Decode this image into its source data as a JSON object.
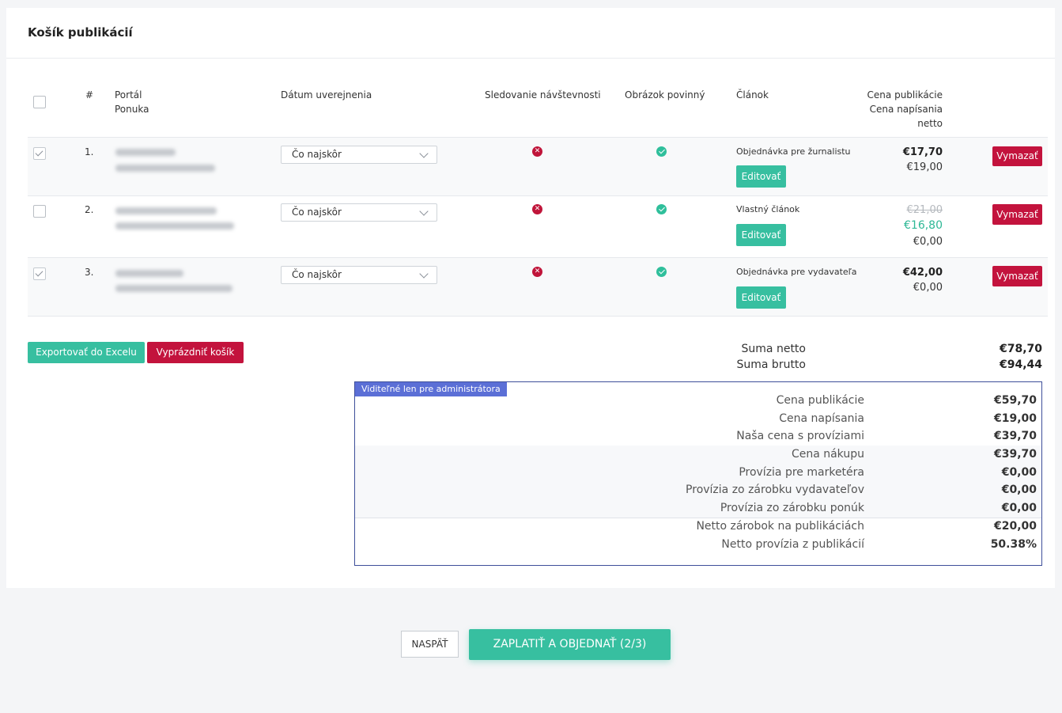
{
  "page": {
    "title": "Košík publikácií"
  },
  "table": {
    "headers": {
      "number": "#",
      "portal": "Portál",
      "offer": "Ponuka",
      "publish_date": "Dátum uverejnenia",
      "tracking": "Sledovanie návštevnosti",
      "image_required": "Obrázok povinný",
      "article": "Článok",
      "price_publication": "Cena publikácie",
      "price_writing": "Cena napísania",
      "net": "netto"
    },
    "rows": [
      {
        "checked": true,
        "number": "1.",
        "date_value": "Čo najskôr",
        "tracking": "no",
        "image_required": "yes",
        "article_type": "Objednávka pre žurnalistu",
        "edit_label": "Editovať",
        "price_main": "€17,70",
        "price_old": "",
        "price_discounted": "",
        "price_writing": "€19,00",
        "delete_label": "Vymazať"
      },
      {
        "checked": false,
        "number": "2.",
        "date_value": "Čo najskôr",
        "tracking": "no",
        "image_required": "yes",
        "article_type": "Vlastný článok",
        "edit_label": "Editovať",
        "price_main": "",
        "price_old": "€21,00",
        "price_discounted": "€16,80",
        "price_writing": "€0,00",
        "delete_label": "Vymazať"
      },
      {
        "checked": true,
        "number": "3.",
        "date_value": "Čo najskôr",
        "tracking": "no",
        "image_required": "yes",
        "article_type": "Objednávka pre vydavateľa",
        "edit_label": "Editovať",
        "price_main": "€42,00",
        "price_old": "",
        "price_discounted": "",
        "price_writing": "€0,00",
        "delete_label": "Vymazať"
      }
    ]
  },
  "actions": {
    "export_label": "Exportovať do Excelu",
    "empty_label": "Vyprázdniť košík"
  },
  "summary": {
    "net_label": "Suma netto",
    "net_value": "€78,70",
    "gross_label": "Suma brutto",
    "gross_value": "€94,44"
  },
  "admin": {
    "tag": "Viditeľné len pre administrátora",
    "rows": [
      {
        "label": "Cena publikácie",
        "value": "€59,70"
      },
      {
        "label": "Cena napísania",
        "value": "€19,00"
      },
      {
        "label": "Naša cena s províziami",
        "value": "€39,70"
      },
      {
        "label": "Cena nákupu",
        "value": "€39,70"
      },
      {
        "label": "Provízia pre marketéra",
        "value": "€0,00"
      },
      {
        "label": "Provízia zo zárobku vydavateľov",
        "value": "€0,00"
      },
      {
        "label": "Provízia zo zárobku ponúk",
        "value": "€0,00"
      },
      {
        "label": "Netto zárobok na publikáciách",
        "value": "€20,00"
      },
      {
        "label": "Netto provízia z publikácií",
        "value": "50.38%"
      }
    ]
  },
  "footer": {
    "back_label": "NASPÄŤ",
    "pay_label": "ZAPLATIŤ A OBJEDNAŤ (2/3)"
  },
  "colors": {
    "accent_teal": "#37bfa0",
    "danger_red": "#c3133d",
    "admin_blue": "#5b6fd6"
  }
}
